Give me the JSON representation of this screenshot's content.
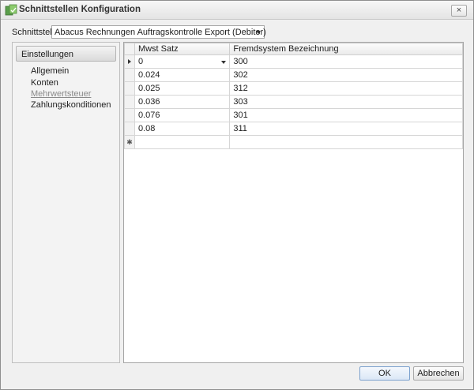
{
  "window": {
    "title": "Schnittstellen Konfiguration",
    "icon": "app-icon",
    "close_label": "×"
  },
  "interface": {
    "label": "Schnittstelle",
    "value": "Abacus Rechnungen Auftragskontrolle Export (Debitor)"
  },
  "nav": {
    "header": "Einstellungen",
    "items": [
      "Allgemein",
      "Konten",
      "Mehrwertsteuer",
      "Zahlungskonditionen"
    ],
    "active_index": 2
  },
  "grid": {
    "columns": [
      "Mwst Satz",
      "Fremdsystem Bezeichnung"
    ],
    "rows": [
      [
        "0",
        "300"
      ],
      [
        "0.024",
        "302"
      ],
      [
        "0.025",
        "312"
      ],
      [
        "0.036",
        "303"
      ],
      [
        "0.076",
        "301"
      ],
      [
        "0.08",
        "311"
      ]
    ],
    "new_row_marker": "✱"
  },
  "buttons": {
    "ok": "OK",
    "cancel": "Abbrechen"
  }
}
